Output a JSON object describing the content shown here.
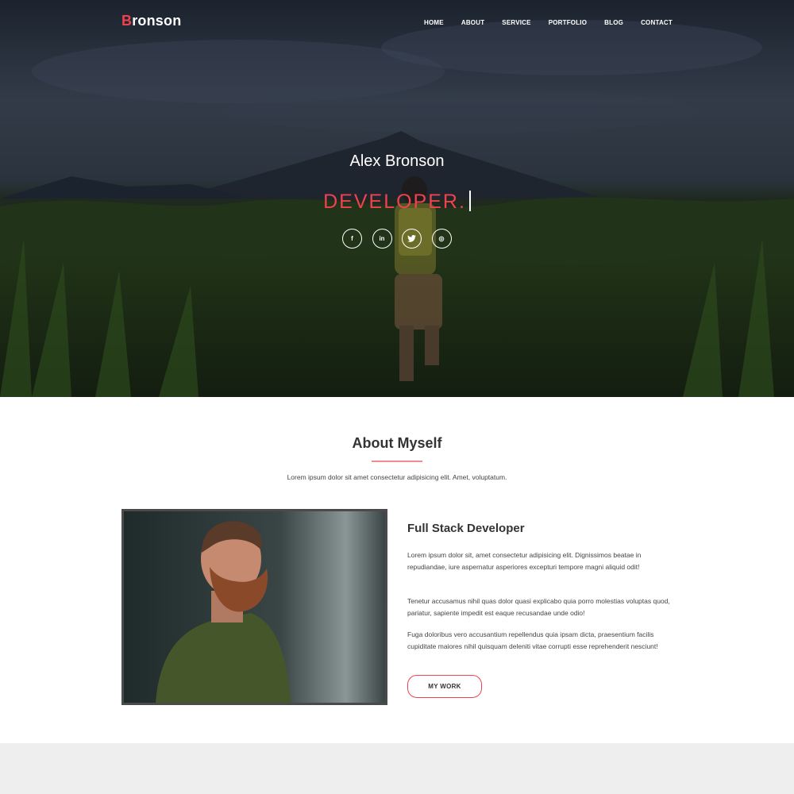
{
  "brand": {
    "first_letter": "B",
    "rest": "ronson"
  },
  "nav": {
    "items": [
      "HOME",
      "ABOUT",
      "SERVICE",
      "PORTFOLIO",
      "BLOG",
      "CONTACT"
    ]
  },
  "hero": {
    "name": "Alex Bronson",
    "role": "DEVELOPER.",
    "socials": [
      {
        "icon": "facebook-icon",
        "glyph": "f"
      },
      {
        "icon": "linkedin-icon",
        "glyph": "in"
      },
      {
        "icon": "twitter-icon",
        "glyph": "t"
      },
      {
        "icon": "dribbble-icon",
        "glyph": "◎"
      }
    ]
  },
  "about": {
    "title": "About Myself",
    "subtitle": "Lorem ipsum dolor sit amet consectetur adipisicing elit. Amet, voluptatum.",
    "heading": "Full Stack Developer",
    "paragraphs": [
      "Lorem ipsum dolor sit, amet consectetur adipisicing elit. Dignissimos beatae in repudiandae, iure aspernatur asperiores excepturi tempore magni aliquid odit!",
      "Tenetur accusamus nihil quas dolor quasi explicabo quia porro molestias voluptas quod, pariatur, sapiente impedit est eaque recusandae unde odio!",
      "Fuga doloribus vero accusantium repellendus quia ipsam dicta, praesentium facilis cupiditate maiores nihil quisquam deleniti vitae corrupti esse reprehenderit nesciunt!"
    ],
    "button": "MY WORK"
  },
  "colors": {
    "accent": "#f0414f",
    "text": "#333333",
    "footer_band": "#eeeeee"
  }
}
